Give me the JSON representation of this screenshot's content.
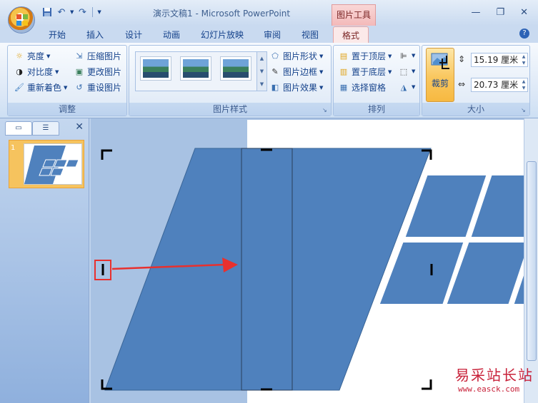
{
  "titlebar": {
    "title": "演示文稿1 - Microsoft PowerPoint",
    "contextual_tab": "图片工具"
  },
  "tabs": [
    {
      "label": "开始"
    },
    {
      "label": "插入"
    },
    {
      "label": "设计"
    },
    {
      "label": "动画"
    },
    {
      "label": "幻灯片放映"
    },
    {
      "label": "审阅"
    },
    {
      "label": "视图"
    },
    {
      "label": "格式"
    }
  ],
  "ribbon": {
    "adjust": {
      "label": "调整",
      "brightness": "亮度",
      "contrast": "对比度",
      "recolor": "重新着色",
      "compress": "压缩图片",
      "change_picture": "更改图片",
      "reset_picture": "重设图片"
    },
    "picture_styles": {
      "label": "图片样式",
      "shape": "图片形状",
      "border": "图片边框",
      "effects": "图片效果"
    },
    "arrange": {
      "label": "排列",
      "bring_front": "置于顶层",
      "send_back": "置于底层",
      "selection_pane": "选择窗格"
    },
    "size": {
      "label": "大小",
      "crop": "裁剪",
      "height": "15.19 厘米",
      "width": "20.73 厘米"
    }
  },
  "slides_panel": {
    "slide_number": "1"
  },
  "watermark": {
    "text": "易采站长站",
    "url": "www.easck.com"
  },
  "colors": {
    "shape_fill": "#4f81bd",
    "shape_stroke": "#3a6597",
    "arrow": "#e8302e",
    "highlight_box": "#e8302e",
    "accent_contextual": "#f3b9b9",
    "crop_active": "#f9c75e"
  }
}
